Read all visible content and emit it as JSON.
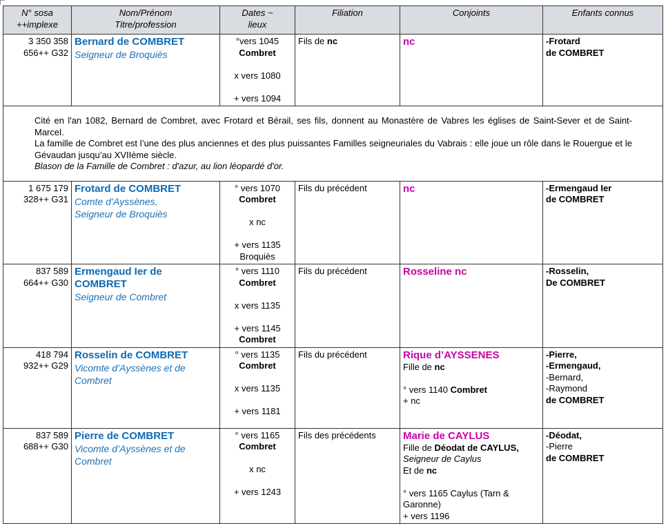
{
  "headers": {
    "sosa": [
      "N° sosa",
      "++implexe"
    ],
    "name": [
      "Nom/Prénom",
      "Titre/profession"
    ],
    "dates": [
      "Dates ~",
      "lieux"
    ],
    "filiation": "Filiation",
    "spouses": "Conjoints",
    "children": "Enfants connus"
  },
  "rows": [
    {
      "sosa": "3 350 358",
      "implexe": "656++ G32",
      "name": "Bernard de COMBRET",
      "titles": [
        "Seigneur de Broquiès"
      ],
      "birth": "°vers 1045",
      "birth_place": "Combret",
      "marriage": "x vers 1080",
      "marriage_place": "",
      "death": "+ vers 1094",
      "death_place": "",
      "filiation": "Fils de ",
      "filiation_bold": "nc",
      "spouse": "nc",
      "children": [
        {
          "t": "-Frotard",
          "b": true
        },
        {
          "t": "de COMBRET",
          "b": true
        }
      ]
    },
    {
      "sosa": "1 675 179",
      "implexe": "328++ G31",
      "name": "Frotard de COMBRET",
      "titles": [
        "Comte d’Ayssènes,",
        "Seigneur de Broquiès"
      ],
      "birth": "° vers 1070",
      "birth_place": "Combret",
      "marriage": "x nc",
      "marriage_place": "",
      "death": "+ vers 1135",
      "death_place": "Broquiès",
      "filiation": "Fils du précédent",
      "filiation_bold": "",
      "spouse": "nc",
      "children": [
        {
          "t": "-Ermengaud Ier",
          "b": true
        },
        {
          "t": "de COMBRET",
          "b": true
        }
      ]
    },
    {
      "sosa": "837 589",
      "implexe": "664++ G30",
      "name": "Ermengaud Ier de COMBRET",
      "titles": [
        "Seigneur de Combret"
      ],
      "birth": "° vers 1110",
      "birth_place": "Combret",
      "marriage": "x vers 1135",
      "marriage_place": "",
      "death": "+ vers 1145",
      "death_place": "Combret",
      "filiation": "Fils du précédent",
      "filiation_bold": "",
      "spouse": "Rosseline nc",
      "children": [
        {
          "t": "-Rosselin,",
          "b": true
        },
        {
          "t": "De COMBRET",
          "b": true
        }
      ]
    },
    {
      "sosa": "418 794",
      "implexe": "932++ G29",
      "name": "Rosselin de COMBRET",
      "titles": [
        "Vicomte d’Ayssènes et de Combret"
      ],
      "birth": "° vers 1135",
      "birth_place": "Combret",
      "marriage": "x vers 1135",
      "marriage_place": "",
      "death": "+ vers 1181",
      "death_place": "",
      "filiation": "Fils du précédent",
      "filiation_bold": "",
      "spouse": "Rique d’AYSSENES",
      "spouse_father_label": "Fille de ",
      "spouse_father": "nc",
      "spouse_father_title": "",
      "spouse_mother_label": "",
      "spouse_mother": "",
      "spouse_birth": "° vers 1140 ",
      "spouse_birth_place": "Combret",
      "spouse_death": "+ nc",
      "children": [
        {
          "t": "-Pierre,",
          "b": true
        },
        {
          "t": "-Ermengaud,",
          "b": true
        },
        {
          "t": "-Bernard,",
          "b": false
        },
        {
          "t": "-Raymond",
          "b": false
        },
        {
          "t": "de COMBRET",
          "b": true
        }
      ]
    },
    {
      "sosa": "837 589",
      "implexe": "688++ G30",
      "name": "Pierre de COMBRET",
      "titles": [
        "Vicomte d’Ayssènes et de Combret"
      ],
      "birth": "° vers 1165",
      "birth_place": "Combret",
      "marriage": "x nc",
      "marriage_place": "",
      "death": "+ vers 1243",
      "death_place": "",
      "filiation": "Fils des précédents",
      "filiation_bold": "",
      "spouse": "Marie de CAYLUS",
      "spouse_father_label": "Fille de ",
      "spouse_father": "Déodat de CAYLUS,",
      "spouse_father_title": "Seigneur de Caylus",
      "spouse_mother_label": "Et de ",
      "spouse_mother": "nc",
      "spouse_birth": "° vers 1165 Caylus (Tarn & Garonne)",
      "spouse_birth_place": "",
      "spouse_death": "+ vers 1196",
      "children": [
        {
          "t": "-Déodat,",
          "b": true
        },
        {
          "t": "-Pierre",
          "b": false
        },
        {
          "t": "de COMBRET",
          "b": true
        }
      ]
    }
  ],
  "note": {
    "line1": "Cité en l'an 1082, Bernard de Combret, avec Frotard et Bérail, ses fils, donnent au Monastère de Vabres les églises de Saint-Sever et de Saint-Marcel.",
    "line2": "La famille de Combret est l’une des plus anciennes et des plus puissantes Familles seigneuriales du Vabrais : elle joue un rôle dans le Rouergue et le Gévaudan jusqu’au XVIIème siècle.",
    "line3": "Blason de la Famille de Combret : d'azur, au lion léopardé d'or."
  }
}
